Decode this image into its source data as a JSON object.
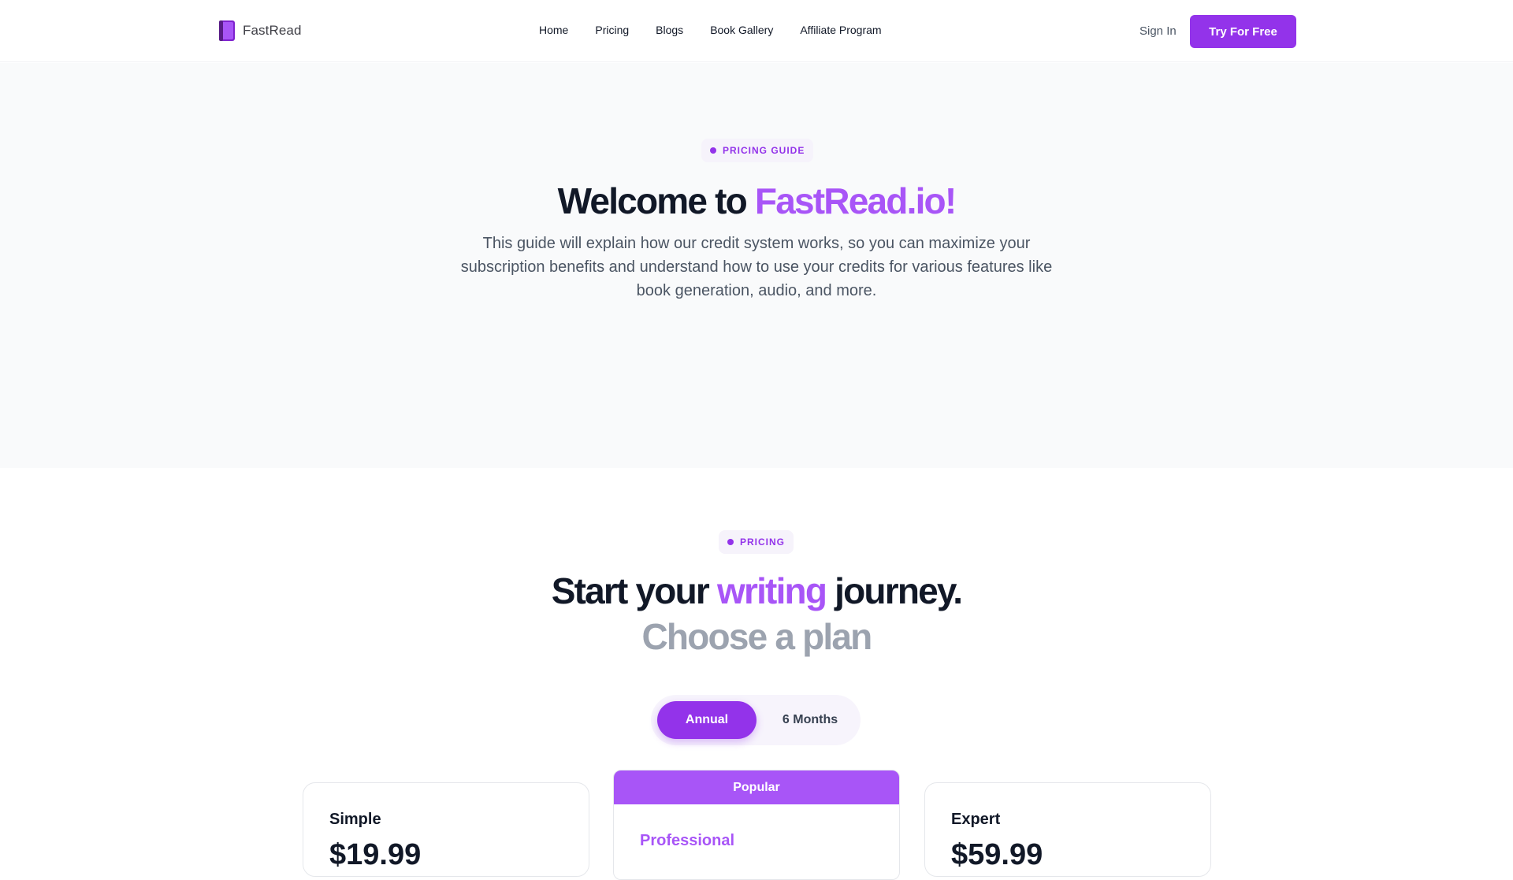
{
  "header": {
    "brand": "FastRead",
    "nav": [
      "Home",
      "Pricing",
      "Blogs",
      "Book Gallery",
      "Affiliate Program"
    ],
    "sign_in": "Sign In",
    "cta": "Try For Free",
    "logo_icon": "book-icon"
  },
  "hero": {
    "badge": "PRICING GUIDE",
    "title_prefix": "Welcome to ",
    "title_accent": "FastRead.io!",
    "description": "This guide will explain how our credit system works, so you can maximize your subscription benefits and understand how to use your credits for various features like book generation, audio, and more."
  },
  "pricing": {
    "badge": "PRICING",
    "title_part1": "Start your ",
    "title_accent": "writing",
    "title_part2": " journey.",
    "subtitle": "Choose a plan",
    "toggle": {
      "active": "Annual",
      "inactive": "6 Months"
    },
    "plans": [
      {
        "name": "Simple",
        "price": "$19.99"
      },
      {
        "name": "Professional",
        "badge": "Popular"
      },
      {
        "name": "Expert",
        "price": "$59.99"
      }
    ]
  },
  "colors": {
    "accent": "#9333ea",
    "accent_light": "#a855f7",
    "hero_bg": "#f9fafb",
    "muted": "#9ca3af"
  }
}
